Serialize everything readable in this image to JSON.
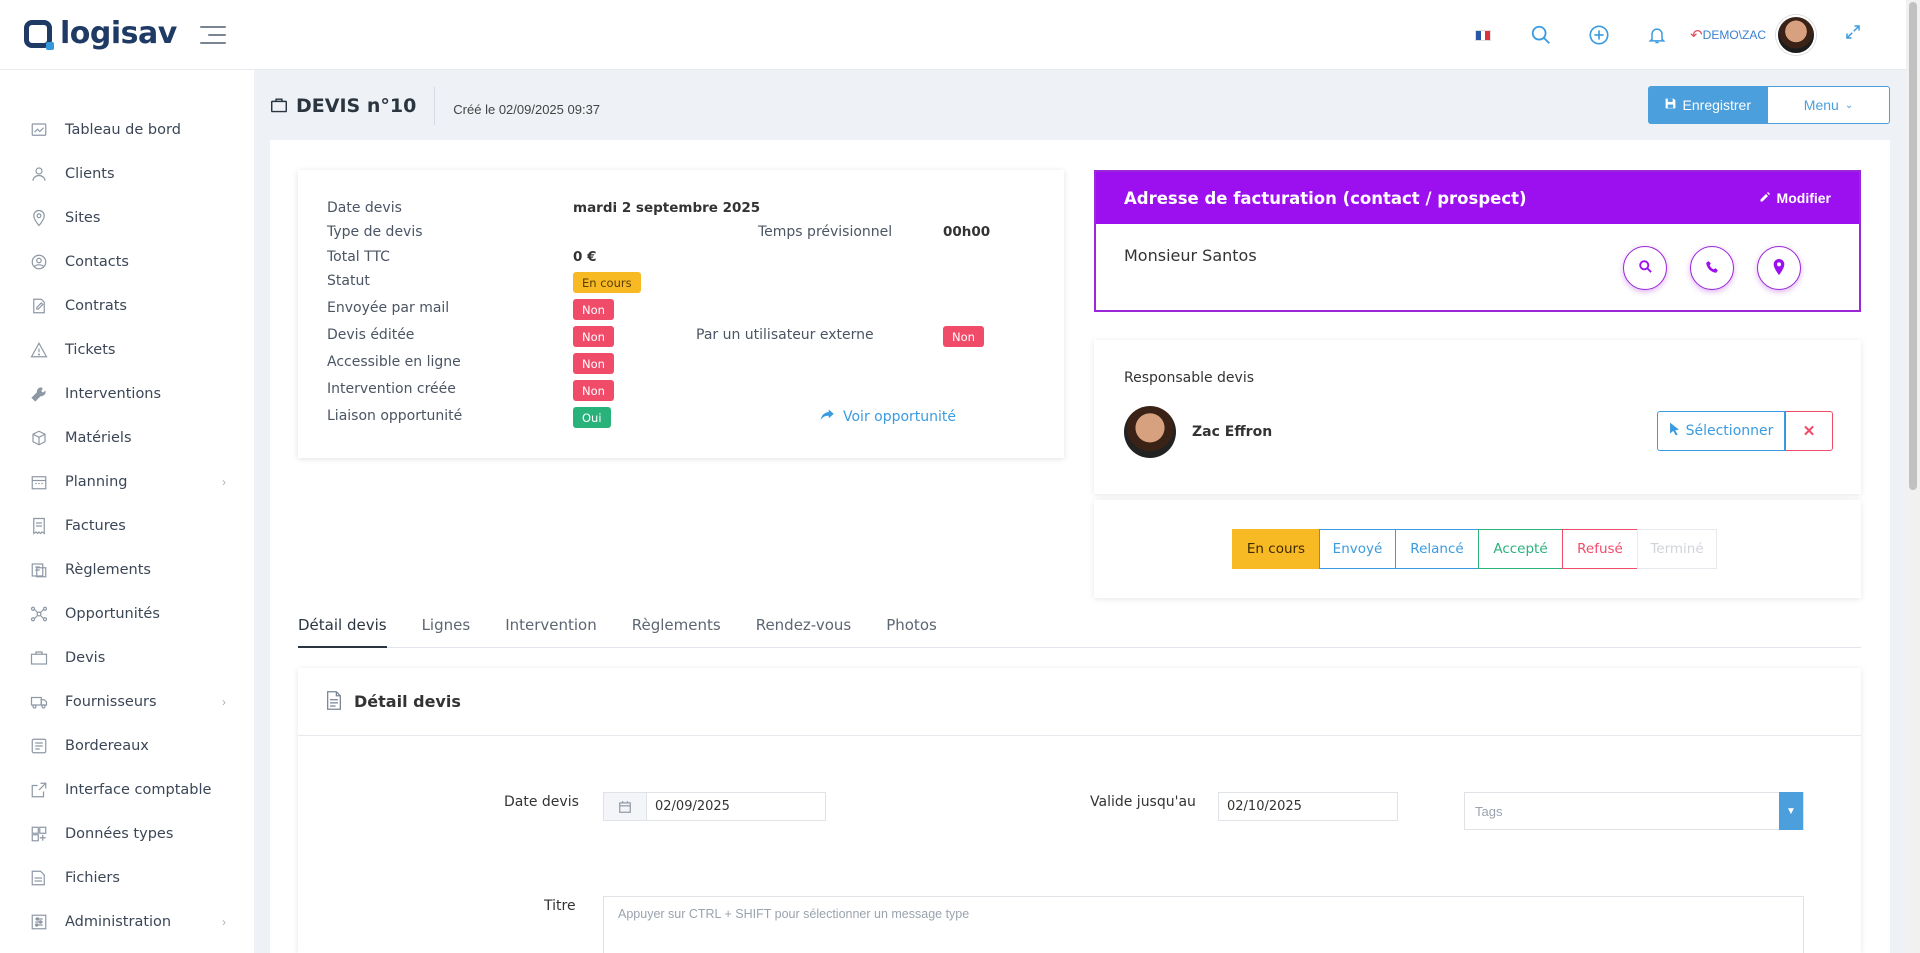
{
  "brand": {
    "name": "logisav"
  },
  "topbar": {
    "demo_label": "DEMO",
    "user_label": "\\ZAC"
  },
  "sidebar": {
    "items": [
      {
        "label": "Tableau de bord",
        "icon": "dashboard-icon"
      },
      {
        "label": "Clients",
        "icon": "users-icon"
      },
      {
        "label": "Sites",
        "icon": "map-pin-icon"
      },
      {
        "label": "Contacts",
        "icon": "contact-icon"
      },
      {
        "label": "Contrats",
        "icon": "contract-icon"
      },
      {
        "label": "Tickets",
        "icon": "warning-icon"
      },
      {
        "label": "Interventions",
        "icon": "wrench-icon"
      },
      {
        "label": "Matériels",
        "icon": "box-icon"
      },
      {
        "label": "Planning",
        "icon": "calendar-icon",
        "has_children": true
      },
      {
        "label": "Factures",
        "icon": "invoice-icon"
      },
      {
        "label": "Règlements",
        "icon": "payment-icon"
      },
      {
        "label": "Opportunités",
        "icon": "network-icon"
      },
      {
        "label": "Devis",
        "icon": "briefcase-icon"
      },
      {
        "label": "Fournisseurs",
        "icon": "truck-icon",
        "has_children": true
      },
      {
        "label": "Bordereaux",
        "icon": "slip-icon"
      },
      {
        "label": "Interface comptable",
        "icon": "external-link-icon"
      },
      {
        "label": "Données types",
        "icon": "grid-icon"
      },
      {
        "label": "Fichiers",
        "icon": "folder-icon"
      },
      {
        "label": "Administration",
        "icon": "sliders-icon",
        "has_children": true
      }
    ]
  },
  "header": {
    "title": "DEVIS n°10",
    "created": "Créé le 02/09/2025 09:37",
    "save_label": "Enregistrer",
    "menu_label": "Menu"
  },
  "info": {
    "date_label": "Date devis",
    "date_value": "mardi 2 septembre 2025",
    "type_label": "Type de devis",
    "temps_label": "Temps prévisionnel",
    "temps_value": "00h00",
    "total_label": "Total TTC",
    "total_value": "0 €",
    "statut_label": "Statut",
    "statut_value": "En cours",
    "mail_label": "Envoyée par mail",
    "mail_value": "Non",
    "editee_label": "Devis éditée",
    "editee_value": "Non",
    "externe_label": "Par un utilisateur externe",
    "externe_value": "Non",
    "enligne_label": "Accessible en ligne",
    "enligne_value": "Non",
    "intervention_label": "Intervention créée",
    "intervention_value": "Non",
    "liaison_label": "Liaison opportunité",
    "liaison_value": "Oui",
    "voir_label": "Voir opportunité"
  },
  "billing": {
    "title": "Adresse de facturation (contact / prospect)",
    "edit_label": "Modifier",
    "name": "Monsieur Santos"
  },
  "responsable": {
    "title": "Responsable devis",
    "name": "Zac Effron",
    "select_label": "Sélectionner"
  },
  "status_buttons": [
    {
      "label": "En cours",
      "color": "#f7b924",
      "active": true
    },
    {
      "label": "Envoyé",
      "color": "#3a9be0"
    },
    {
      "label": "Relancé",
      "color": "#3a9be0"
    },
    {
      "label": "Accepté",
      "color": "#2ab27b"
    },
    {
      "label": "Refusé",
      "color": "#f14b6a"
    },
    {
      "label": "Terminé",
      "color": "#d0d4da",
      "disabled": true
    }
  ],
  "tabs": [
    "Détail devis",
    "Lignes",
    "Intervention",
    "Règlements",
    "Rendez-vous",
    "Photos"
  ],
  "detail": {
    "title": "Détail devis",
    "date_label": "Date devis",
    "date_value": "02/09/2025",
    "valid_label": "Valide jusqu'au",
    "valid_value": "02/10/2025",
    "tags_placeholder": "Tags",
    "titre_label": "Titre",
    "titre_placeholder": "Appuyer sur CTRL + SHIFT pour sélectionner un message type"
  },
  "colors": {
    "accent": "#4a9fdc",
    "purple": "#9c10f0",
    "danger": "#f14b6a",
    "success": "#2ab27b",
    "warning": "#f7b924"
  }
}
